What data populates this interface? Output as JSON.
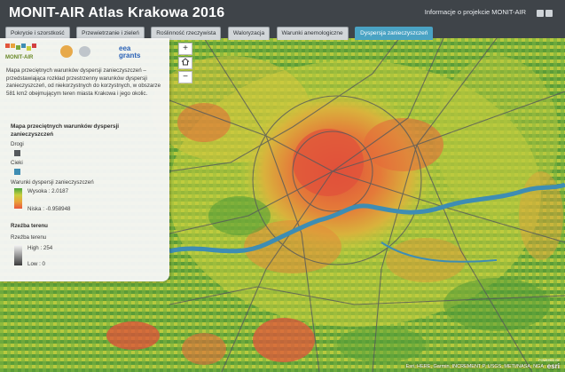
{
  "header": {
    "title": "MONIT-AIR Atlas Krakowa 2016",
    "about": "Informacje o projekcie MONIT-AIR"
  },
  "tabs": [
    {
      "label": "Pokrycie i szorstkość",
      "active": false
    },
    {
      "label": "Przewietrzanie i zieleń",
      "active": false
    },
    {
      "label": "Roślinność rzeczywista",
      "active": false
    },
    {
      "label": "Waloryzacja",
      "active": false
    },
    {
      "label": "Warunki anemologiczne",
      "active": false
    },
    {
      "label": "Dyspersja zanieczyszczeń",
      "active": true
    }
  ],
  "panel": {
    "logos": {
      "monit": "MONIT-AIR",
      "eea_line1": "eea",
      "eea_line2": "grants"
    },
    "description": "Mapa przeciętnych warunków dyspersji zanieczyszczeń – przedstawiająca rozkład przestrzenny warunków dyspersji zanieczyszczeń, od niekorzystnych do korzystnych, w obszarze 581 km2 obejmującym teren miasta Krakowa i jego okolic.",
    "legend_title": "Mapa przeciętnych warunków dyspersji zanieczyszczeń",
    "roads_label": "Drogi",
    "rivers_label": "Cieki",
    "dispersion_label": "Warunki dyspersji zanieczyszczeń",
    "dispersion_high": "Wysoka : 2.0187",
    "dispersion_low": "Niska : -0.958948",
    "relief_heading": "Rzeźba terenu",
    "relief_label": "Rzeźba terenu",
    "relief_high": "High : 254",
    "relief_low": "Low : 0"
  },
  "map": {
    "zoom_in": "+",
    "zoom_out": "−",
    "attribution": "Esri, HERE, Garmin, INCREMENT P, USGS, METI/NASA, NGA",
    "esri": "esri",
    "esri_sub": "POWERED BY",
    "colors": {
      "green": "#5ea83a",
      "yellow": "#c9cf3d",
      "orange": "#e49a37",
      "red": "#e2553b",
      "river": "#3e8db3",
      "roads": "#55595c"
    }
  }
}
